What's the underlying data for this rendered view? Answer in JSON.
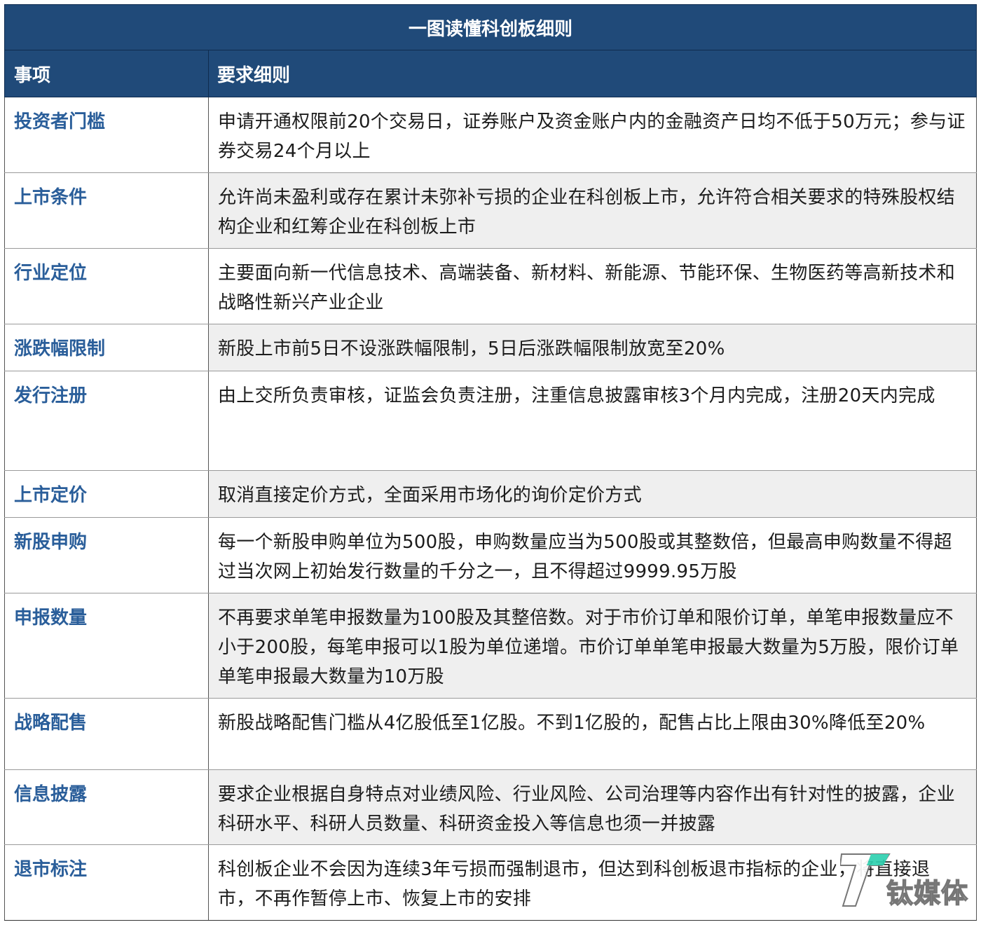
{
  "table": {
    "title": "一图读懂科创板细则",
    "headers": {
      "col1": "事项",
      "col2": "要求细则"
    },
    "rows": [
      {
        "item": "投资者门槛",
        "detail": "申请开通权限前20个交易日，证券账户及资金账户内的金融资产日均不低于50万元；参与证券交易24个月以上"
      },
      {
        "item": "上市条件",
        "detail": "允许尚未盈利或存在累计未弥补亏损的企业在科创板上市，允许符合相关要求的特殊股权结构企业和红筹企业在科创板上市"
      },
      {
        "item": "行业定位",
        "detail": "主要面向新一代信息技术、高端装备、新材料、新能源、节能环保、生物医药等高新技术和战略性新兴产业企业"
      },
      {
        "item": "涨跌幅限制",
        "detail": "新股上市前5日不设涨跌幅限制，5日后涨跌幅限制放宽至20%"
      },
      {
        "item": "发行注册",
        "detail": "由上交所负责审核，证监会负责注册，注重信息披露审核3个月内完成，注册20天内完成"
      },
      {
        "item": "上市定价",
        "detail": "取消直接定价方式，全面采用市场化的询价定价方式"
      },
      {
        "item": "新股申购",
        "detail": "每一个新股申购单位为500股，申购数量应当为500股或其整数倍，但最高申购数量不得超过当次网上初始发行数量的千分之一，且不得超过9999.95万股"
      },
      {
        "item": "申报数量",
        "detail": "不再要求单笔申报数量为100股及其整倍数。对于市价订单和限价订单，单笔申报数量应不小于200股，每笔申报可以1股为单位递增。市价订单单笔申报最大数量为5万股，限价订单单笔申报最大数量为10万股"
      },
      {
        "item": "战略配售",
        "detail": "新股战略配售门槛从4亿股低至1亿股。不到1亿股的，配售占比上限由30%降低至20%"
      },
      {
        "item": "信息披露",
        "detail": "要求企业根据自身特点对业绩风险、行业风险、公司治理等内容作出有针对性的披露，企业科研水平、科研人员数量、科研资金投入等信息也须一并披露"
      },
      {
        "item": "退市标注",
        "detail": "科创板企业不会因为连续3年亏损而强制退市，但达到科创板退市指标的企业，将直接退市，不再作暂停上市、恢复上市的安排"
      }
    ]
  },
  "watermark": {
    "text": "钛媒体",
    "icon": "tmtpost-logo-icon"
  }
}
